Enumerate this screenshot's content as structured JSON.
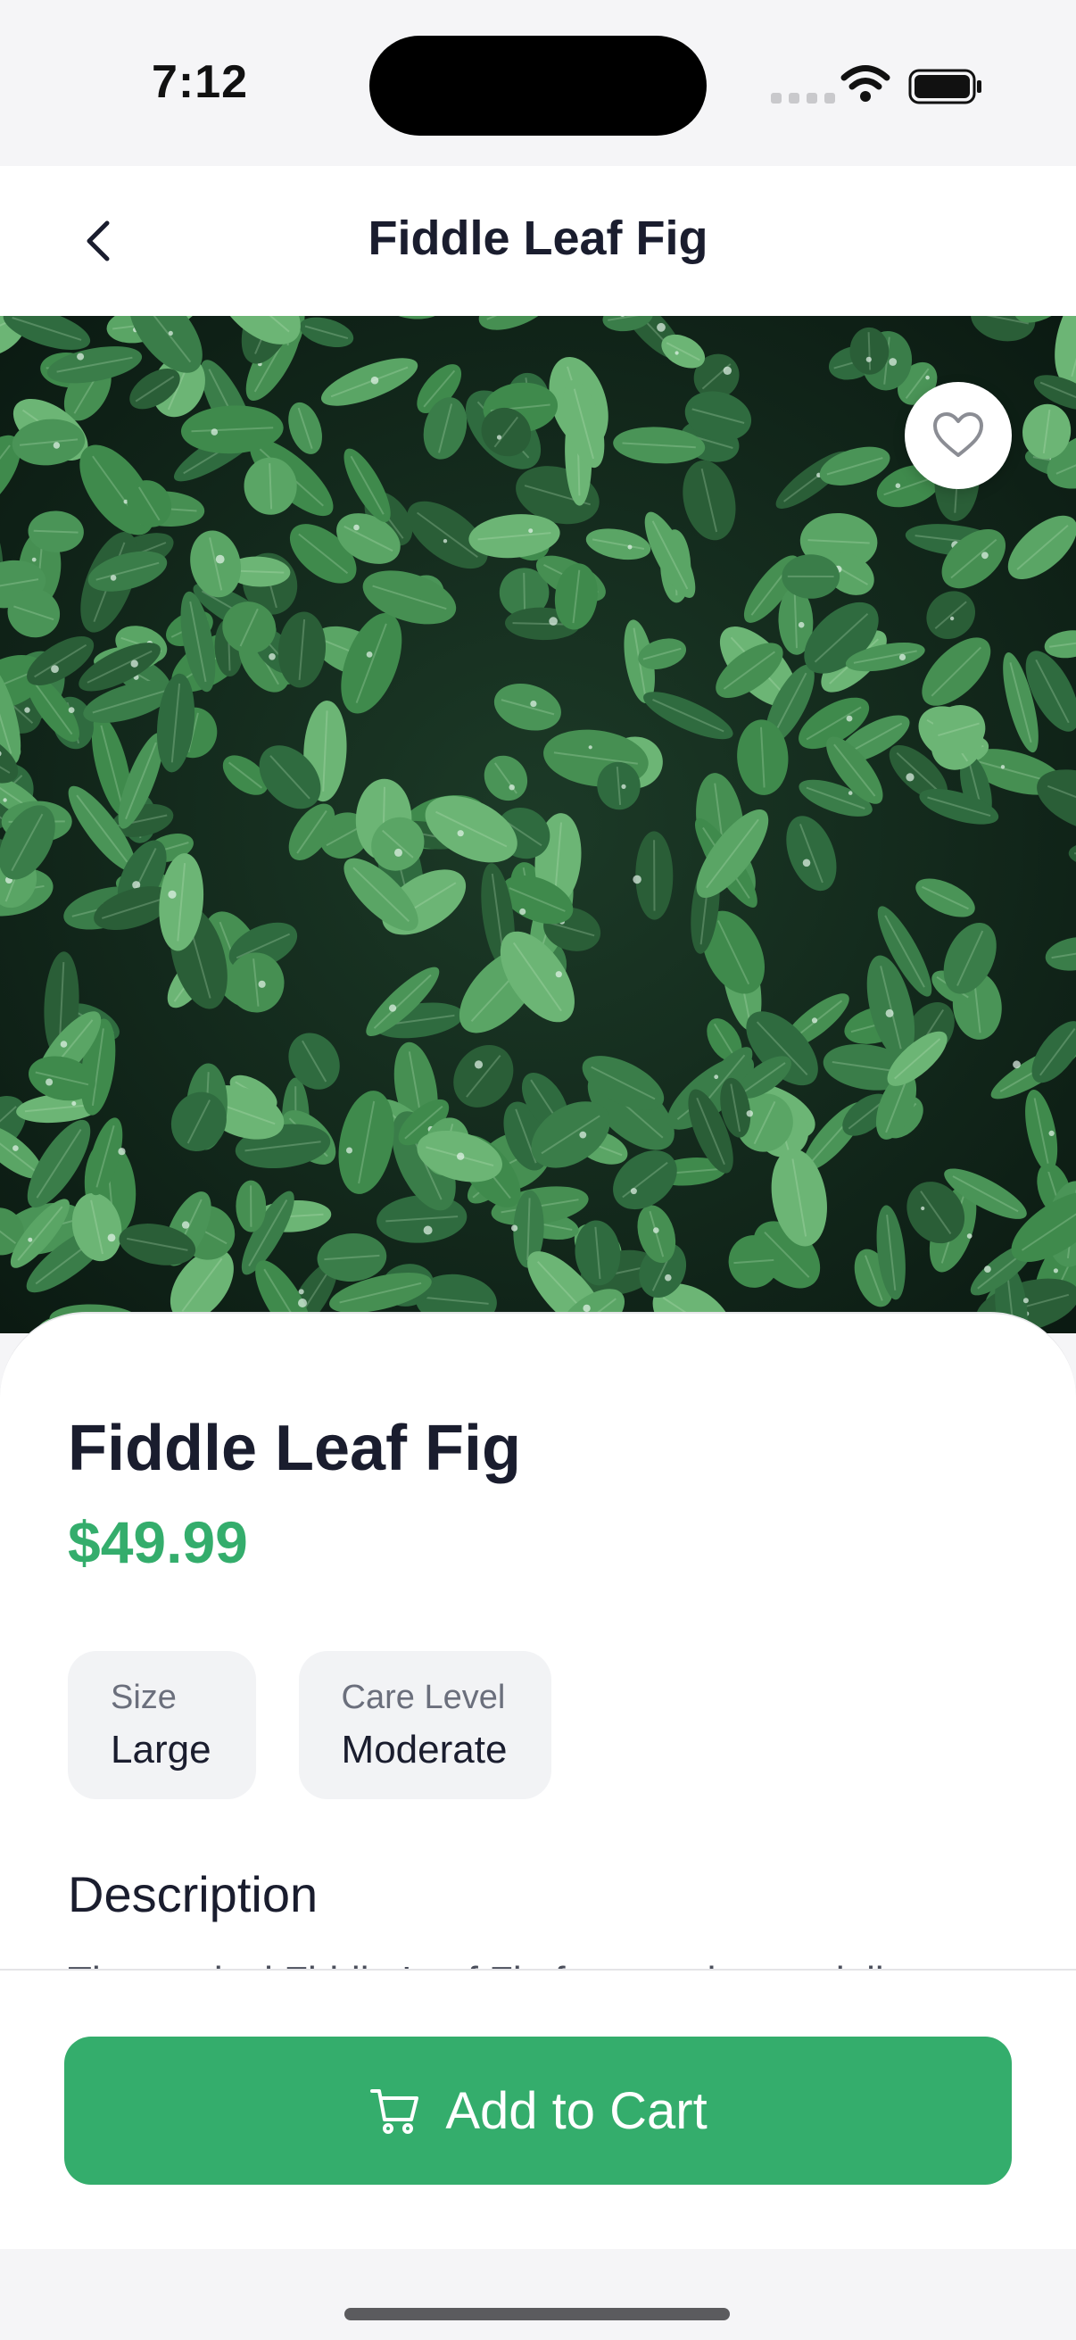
{
  "status_bar": {
    "time": "7:12",
    "icons": [
      "signal-icon",
      "wifi-icon",
      "battery-icon"
    ]
  },
  "header": {
    "title": "Fiddle Leaf Fig",
    "back_icon": "chevron-left-icon"
  },
  "hero": {
    "image": "plant-foliage-photo",
    "favorite_icon": "heart-outline-icon"
  },
  "product": {
    "name": "Fiddle Leaf Fig",
    "price": "$49.99",
    "attributes": [
      {
        "label": "Size",
        "value": "Large"
      },
      {
        "label": "Care Level",
        "value": "Moderate"
      }
    ],
    "description_title": "Description",
    "description_preview": "The tropical Fiddle Leaf Fig features large, violin"
  },
  "actions": {
    "add_to_cart_label": "Add to Cart",
    "cart_icon": "cart-icon"
  },
  "colors": {
    "accent": "#34ad6c",
    "text_primary": "#1a1d2e",
    "background": "#f5f5f7"
  }
}
